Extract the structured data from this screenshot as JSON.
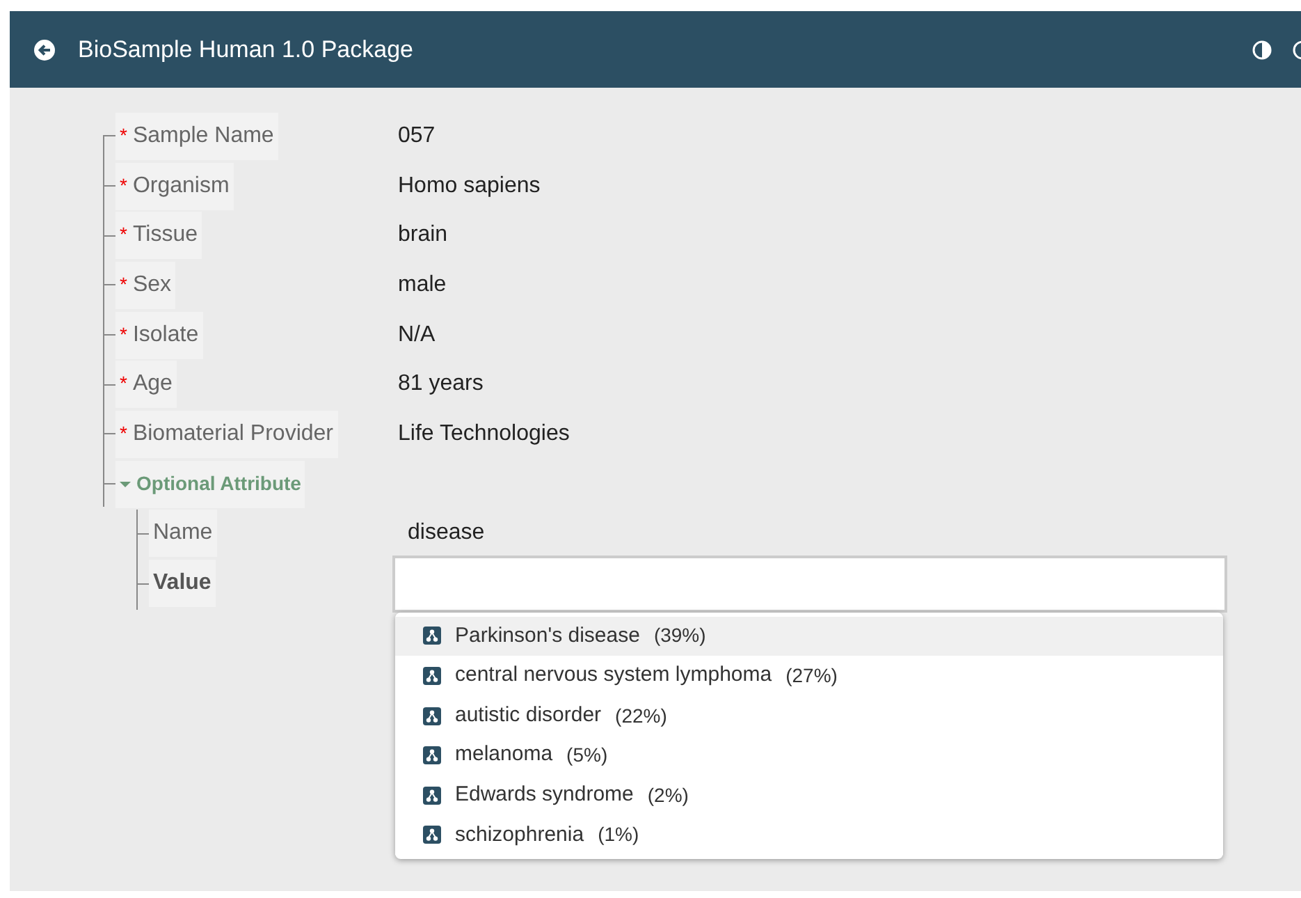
{
  "header": {
    "title": "BioSample Human 1.0 Package"
  },
  "fields": [
    {
      "label": "Sample Name",
      "required_mark": "*",
      "value": "057"
    },
    {
      "label": "Organism",
      "required_mark": "*",
      "value": "Homo sapiens"
    },
    {
      "label": "Tissue",
      "required_mark": "*",
      "value": "brain"
    },
    {
      "label": "Sex",
      "required_mark": "*",
      "value": "male"
    },
    {
      "label": "Isolate",
      "required_mark": "*",
      "value": "N/A"
    },
    {
      "label": "Age",
      "required_mark": "*",
      "value": "81 years"
    },
    {
      "label": "Biomaterial Provider",
      "required_mark": "*",
      "value": "Life Technologies"
    }
  ],
  "optional": {
    "label": "Optional Attribute",
    "expanded": true,
    "name": {
      "label": "Name",
      "value": "disease"
    },
    "value": {
      "label": "Value"
    }
  },
  "suggestions": [
    {
      "text": "Parkinson's disease",
      "percent": "(39%)",
      "selected": true
    },
    {
      "text": "central nervous system lymphoma",
      "percent": "(27%)",
      "selected": false
    },
    {
      "text": "autistic disorder",
      "percent": "(22%)",
      "selected": false
    },
    {
      "text": "melanoma",
      "percent": "(5%)",
      "selected": false
    },
    {
      "text": "Edwards syndrome",
      "percent": "(2%)",
      "selected": false
    },
    {
      "text": "schizophrenia",
      "percent": "(1%)",
      "selected": false
    }
  ]
}
